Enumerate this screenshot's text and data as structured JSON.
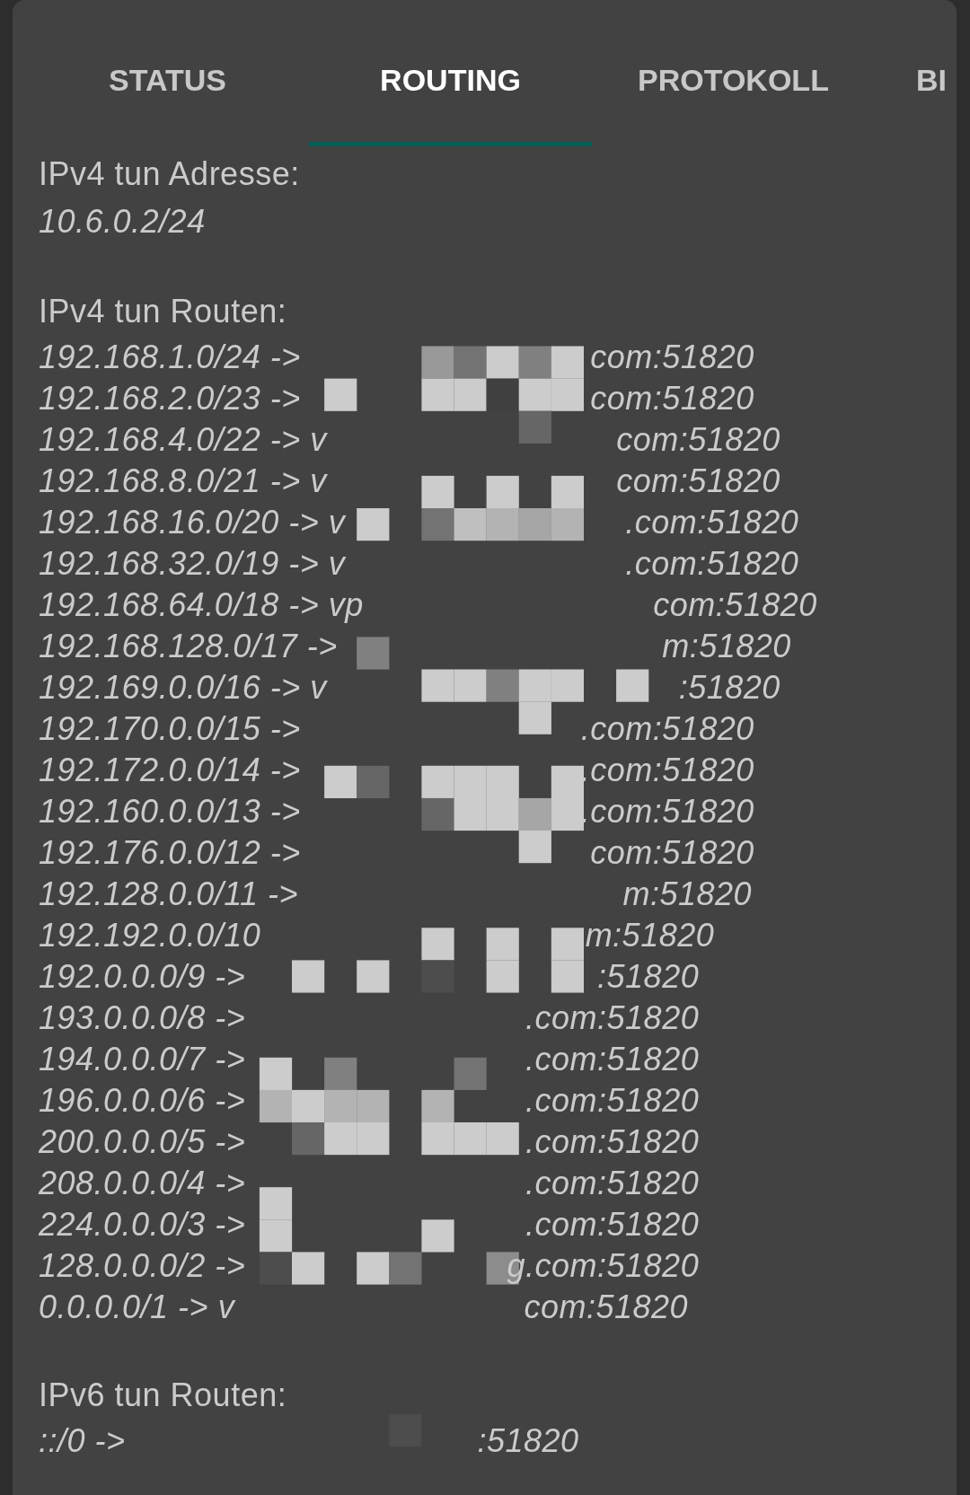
{
  "tabs": [
    {
      "label": "STATUS",
      "selected": false
    },
    {
      "label": "ROUTING",
      "selected": true
    },
    {
      "label": "PROTOKOLL",
      "selected": false
    },
    {
      "label": "BI",
      "selected": false
    }
  ],
  "sections": [
    {
      "kind": "address",
      "title": "IPv4 tun Adresse:",
      "value": "10.6.0.2/24"
    },
    {
      "kind": "routes",
      "title": "IPv4 tun Routen:",
      "routes": [
        {
          "prefix": "192.168.1.0/24 ->",
          "suffix": "com:51820"
        },
        {
          "prefix": "192.168.2.0/23 ->",
          "suffix": "com:51820"
        },
        {
          "prefix": "192.168.4.0/22 -> v",
          "suffix": "com:51820"
        },
        {
          "prefix": "192.168.8.0/21 -> v",
          "suffix": "com:51820"
        },
        {
          "prefix": "192.168.16.0/20 -> v",
          "suffix": ".com:51820"
        },
        {
          "prefix": "192.168.32.0/19 -> v",
          "suffix": ".com:51820"
        },
        {
          "prefix": "192.168.64.0/18 -> vp",
          "suffix": "com:51820"
        },
        {
          "prefix": "192.168.128.0/17 ->",
          "suffix": "m:51820"
        },
        {
          "prefix": "192.169.0.0/16 -> v",
          "suffix": ":51820"
        },
        {
          "prefix": "192.170.0.0/15 ->",
          "suffix": ".com:51820"
        },
        {
          "prefix": "192.172.0.0/14 ->",
          "suffix": ".com:51820"
        },
        {
          "prefix": "192.160.0.0/13 ->",
          "suffix": ".com:51820"
        },
        {
          "prefix": "192.176.0.0/12 ->",
          "suffix": "com:51820"
        },
        {
          "prefix": "192.128.0.0/11 ->",
          "suffix": "m:51820"
        },
        {
          "prefix": "192.192.0.0/10",
          "suffix": "m:51820"
        },
        {
          "prefix": "192.0.0.0/9 ->",
          "suffix": ":51820"
        },
        {
          "prefix": "193.0.0.0/8 ->",
          "suffix": ".com:51820"
        },
        {
          "prefix": "194.0.0.0/7 ->",
          "suffix": ".com:51820"
        },
        {
          "prefix": "196.0.0.0/6 ->",
          "suffix": ".com:51820"
        },
        {
          "prefix": "200.0.0.0/5 ->",
          "suffix": ".com:51820"
        },
        {
          "prefix": "208.0.0.0/4 ->",
          "suffix": ".com:51820"
        },
        {
          "prefix": "224.0.0.0/3 ->",
          "suffix": ".com:51820"
        },
        {
          "prefix": "128.0.0.0/2 ->",
          "suffix": "g.com:51820"
        },
        {
          "prefix": "0.0.0.0/1 -> v",
          "suffix": "com:51820"
        }
      ]
    },
    {
      "kind": "routes",
      "title": "IPv6 tun Routen:",
      "routes": [
        {
          "prefix": "::/0 ->",
          "suffix": ":51820"
        }
      ]
    }
  ]
}
